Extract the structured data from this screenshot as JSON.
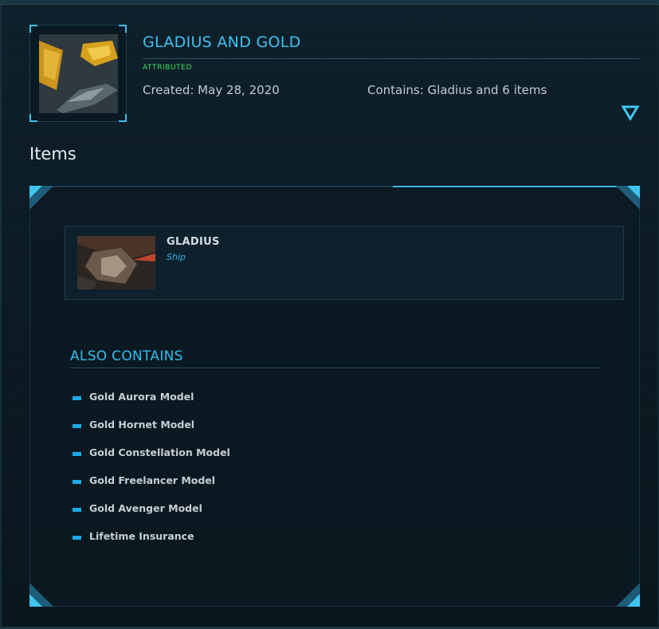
{
  "pledge": {
    "title": "GLADIUS AND GOLD",
    "attribution": "ATTRIBUTED",
    "created": "Created: May 28, 2020",
    "contains": "Contains: Gladius and 6 items"
  },
  "items_section": {
    "heading": "Items",
    "main_item": {
      "name": "GLADIUS",
      "type": "Ship"
    }
  },
  "also_contains": {
    "heading": "ALSO CONTAINS",
    "items": [
      "Gold Aurora Model",
      "Gold Hornet Model",
      "Gold Constellation Model",
      "Gold Freelancer Model",
      "Gold Avenger Model",
      "Lifetime Insurance"
    ]
  },
  "icons": {
    "expand": "chevron-down-triangle-icon",
    "bullet": "dash-bullet-icon"
  },
  "colors": {
    "accent": "#3cc3ef",
    "attributed": "#3ee35a",
    "background": "#0b1b25"
  }
}
